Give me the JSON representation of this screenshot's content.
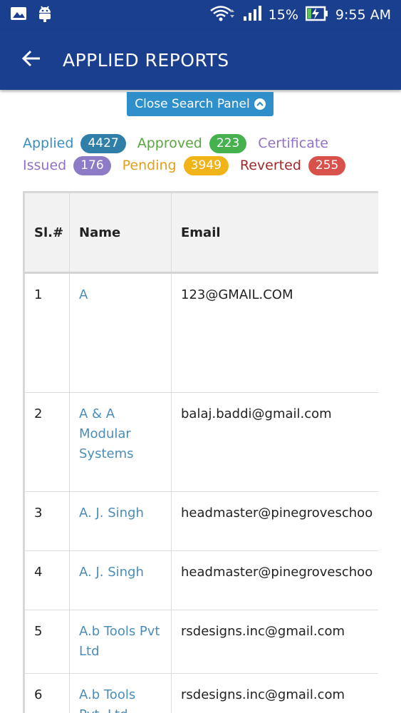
{
  "status_bar": {
    "battery": "15%",
    "time": "9:55 AM"
  },
  "app_bar": {
    "title": "APPLIED REPORTS"
  },
  "search_panel": {
    "toggle_label": "Close Search Panel"
  },
  "stats": {
    "applied": {
      "label": "Applied",
      "count": "4427",
      "label_color": "#3a8fc2",
      "badge_color": "#2f7fa8"
    },
    "approved": {
      "label": "Approved",
      "count": "223",
      "label_color": "#5aa640",
      "badge_color": "#46b14f"
    },
    "certificate_issued": {
      "label_part1": "Certificate",
      "label_part2": "Issued",
      "count": "176",
      "label_color": "#9370c8",
      "badge_color": "#8e7bc7"
    },
    "pending": {
      "label": "Pending",
      "count": "3949",
      "label_color": "#e0a020",
      "badge_color": "#f0b418"
    },
    "reverted": {
      "label": "Reverted",
      "count": "255",
      "label_color": "#a0282a",
      "badge_color": "#d8514a"
    }
  },
  "table": {
    "headers": {
      "sl": "Sl.#",
      "name": "Name",
      "email": "Email"
    },
    "rows": [
      {
        "sl": "1",
        "name": "A",
        "email": "123@GMAIL.COM"
      },
      {
        "sl": "2",
        "name": "A & A Modular Systems",
        "email": "balaj.baddi@gmail.com"
      },
      {
        "sl": "3",
        "name": "A. J. Singh",
        "email": "headmaster@pinegroveschoo"
      },
      {
        "sl": "4",
        "name": "A. J. Singh",
        "email": "headmaster@pinegroveschoo"
      },
      {
        "sl": "5",
        "name": "A.b Tools Pvt Ltd",
        "email": "rsdesigns.inc@gmail.com"
      },
      {
        "sl": "6",
        "name": "A.b Tools Pvt. Ltd",
        "email": "rsdesigns.inc@gmail.com"
      }
    ]
  }
}
